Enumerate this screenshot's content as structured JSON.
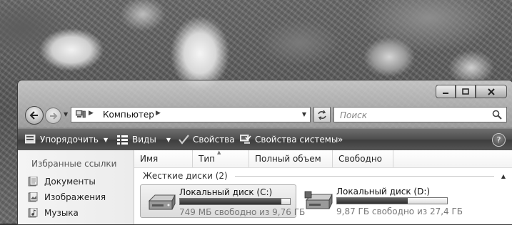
{
  "colors": {
    "toolbar_text": "#ffffff",
    "bar_fill": "#3a3a3a",
    "pane_title": "#555555"
  },
  "window": {
    "controls": {
      "minimize_icon": "minimize-icon",
      "maximize_icon": "maximize-icon",
      "close_icon": "close-icon"
    }
  },
  "nav": {
    "back_icon": "back-arrow-icon",
    "forward_icon": "forward-arrow-icon",
    "breadcrumb": {
      "root_icon": "computer-icon",
      "item": "Компьютер"
    },
    "refresh_icon": "refresh-icon",
    "search": {
      "placeholder": "Поиск",
      "value": ""
    }
  },
  "toolbar": {
    "organize_label": "Упорядочить",
    "views_label": "Виды",
    "properties_label": "Свойства",
    "system_properties_label": "Свойства системы",
    "more_label": "»",
    "help_label": "?"
  },
  "sidebar": {
    "title": "Избранные ссылки",
    "links": [
      {
        "label": "Документы",
        "icon": "documents-icon"
      },
      {
        "label": "Изображения",
        "icon": "pictures-icon"
      },
      {
        "label": "Музыка",
        "icon": "music-icon"
      }
    ]
  },
  "columns": [
    "Имя",
    "Тип",
    "Полный объем",
    "Свободно"
  ],
  "group": {
    "title": "Жесткие диски (2)"
  },
  "drives": [
    {
      "name": "Локальный диск (C:)",
      "free_text": "749 МБ свободно из 9,76 ГБ",
      "used_fraction": 0.925,
      "selected": true
    },
    {
      "name": "Локальный диск (D:)",
      "free_text": "9,87 ГБ свободно из 27,4 ГБ",
      "used_fraction": 0.64,
      "selected": false
    }
  ]
}
